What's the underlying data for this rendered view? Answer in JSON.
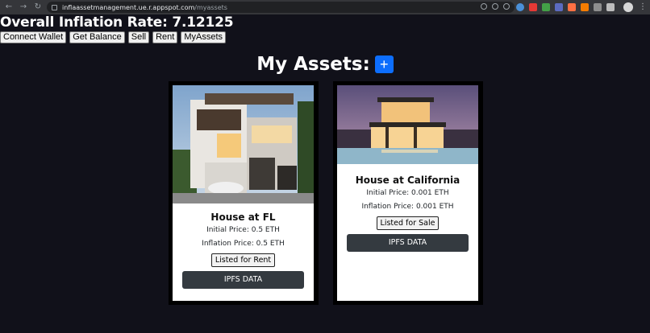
{
  "browser": {
    "url_host": "inflaassetmanagement.ue.r.appspot.com",
    "url_path": "/myassets"
  },
  "page": {
    "inflation_title": "Overall Inflation Rate: 7.12125",
    "nav": [
      "Connect Wallet",
      "Get Balance",
      "Sell",
      "Rent",
      "MyAssets"
    ],
    "assets_title": "My Assets:",
    "add_label": "+"
  },
  "assets": [
    {
      "name": "House at FL",
      "initial_price": "Initial Price: 0.5 ETH",
      "inflation_price": "Inflation Price: 0.5 ETH",
      "status": "Listed for Rent",
      "ipfs_label": "IPFS DATA"
    },
    {
      "name": "House at California",
      "initial_price": "Initial Price: 0.001 ETH",
      "inflation_price": "Inflation Price: 0.001 ETH",
      "status": "Listed for Sale",
      "ipfs_label": "IPFS DATA"
    }
  ],
  "colors": {
    "background": "#11111a",
    "accent": "#0d6efd",
    "ipfs_button": "#343a40"
  }
}
